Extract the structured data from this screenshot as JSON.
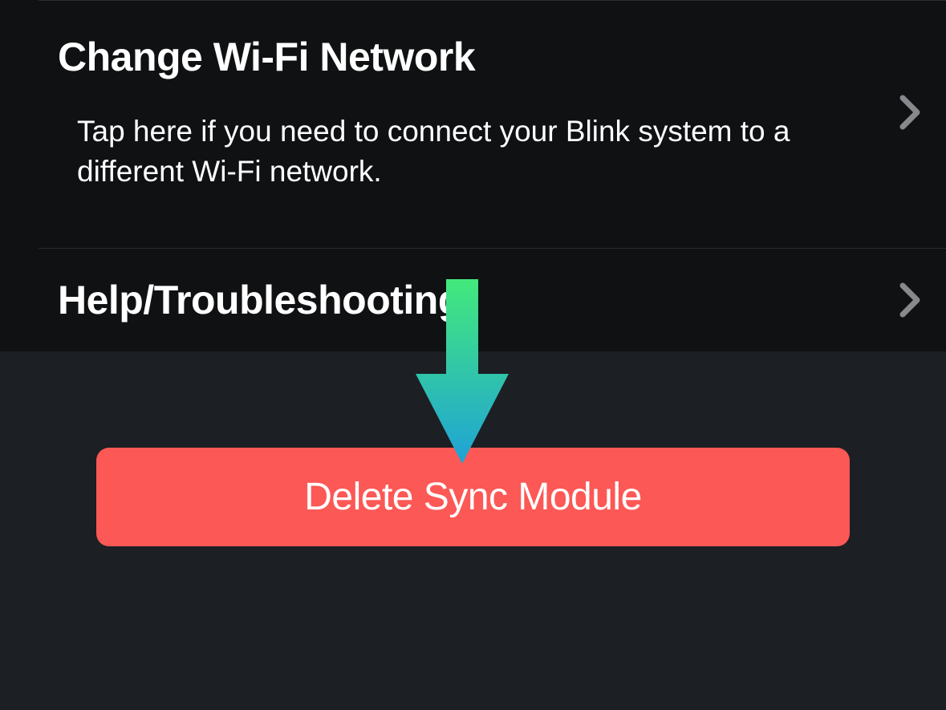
{
  "settings": {
    "wifi": {
      "title": "Change Wi-Fi Network",
      "subtitle": "Tap here if you need to connect your Blink system to a different Wi-Fi network."
    },
    "help": {
      "title": "Help/Troubleshooting"
    }
  },
  "delete": {
    "label": "Delete Sync Module"
  }
}
